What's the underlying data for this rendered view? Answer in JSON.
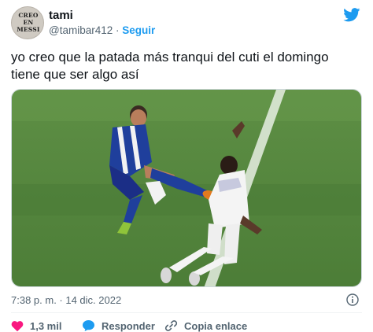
{
  "user": {
    "avatar_text": [
      "CREO",
      "EN",
      "MESSI"
    ],
    "name": "tami",
    "handle": "@tamibar412",
    "separator": "·",
    "follow_label": "Seguir"
  },
  "tweet": {
    "text": "yo creo que la patada más tranqui del cuti el domingo tiene que ser algo así",
    "timestamp": "7:38 p. m. · 14 dic. 2022"
  },
  "actions": {
    "like_count": "1,3 mil",
    "reply_label": "Responder",
    "copy_label": "Copia enlace"
  },
  "icons": {
    "brand": "twitter-bird-icon",
    "info": "info-icon",
    "like": "heart-icon",
    "reply": "reply-bubble-icon",
    "copy": "link-icon"
  },
  "colors": {
    "accent": "#1d9bf0",
    "like": "#f91880",
    "text": "#0f1419",
    "muted": "#536471"
  }
}
